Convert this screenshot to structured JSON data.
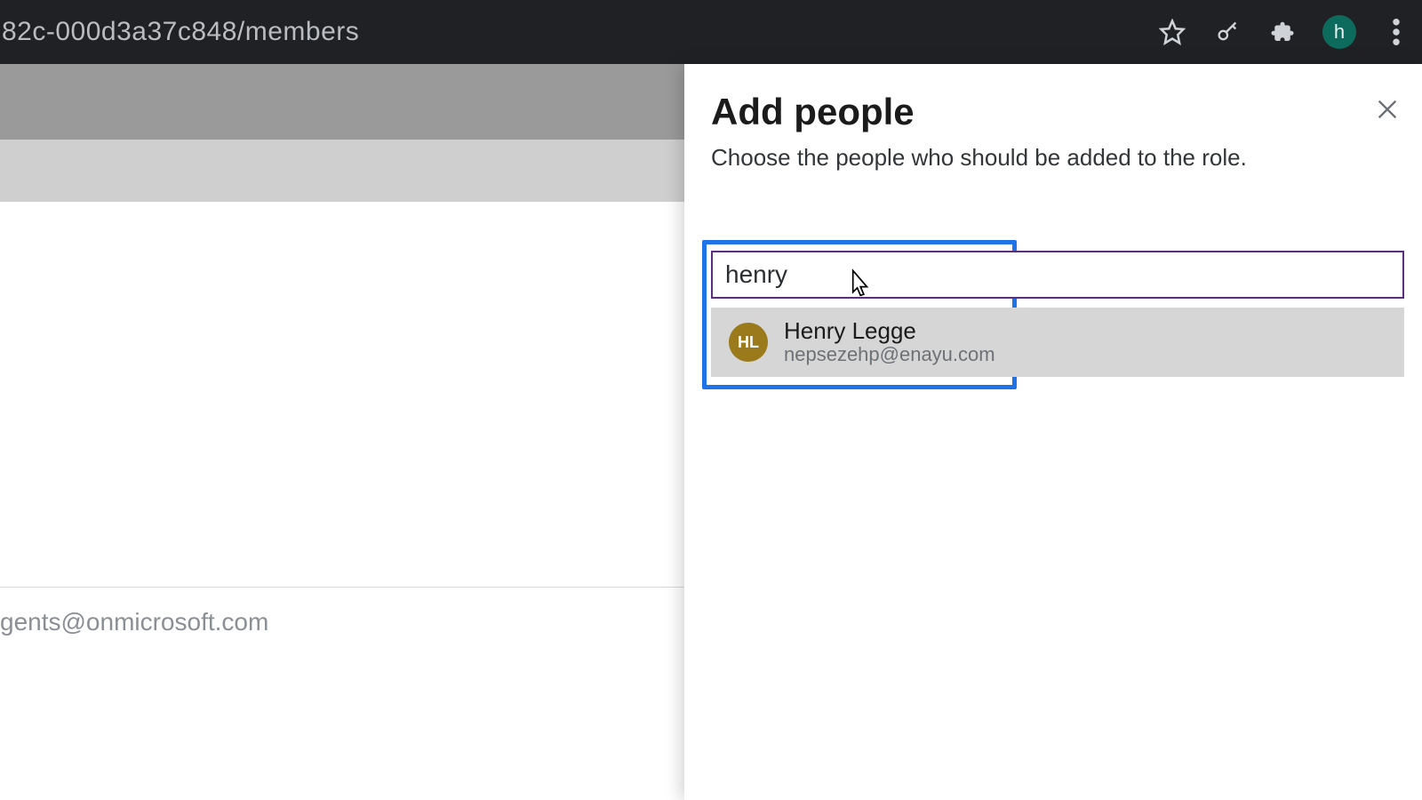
{
  "browser": {
    "url_fragment": "82c-000d3a37c848/members",
    "profile_initial": "h"
  },
  "background": {
    "partial_email": "gents@onmicrosoft.com"
  },
  "panel": {
    "title": "Add people",
    "subtitle": "Choose the people who should be added to the role.",
    "search_value": "henry",
    "suggestion": {
      "initials": "HL",
      "name": "Henry Legge",
      "email": "nepsezehp@enayu.com"
    }
  }
}
